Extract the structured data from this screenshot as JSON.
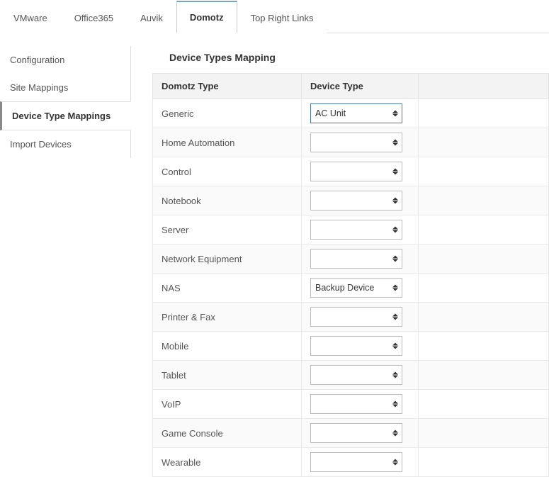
{
  "top_tabs": [
    {
      "label": "VMware",
      "active": false
    },
    {
      "label": "Office365",
      "active": false
    },
    {
      "label": "Auvik",
      "active": false
    },
    {
      "label": "Domotz",
      "active": true
    },
    {
      "label": "Top Right Links",
      "active": false
    }
  ],
  "sidebar": [
    {
      "label": "Configuration",
      "active": false
    },
    {
      "label": "Site Mappings",
      "active": false
    },
    {
      "label": "Device Type Mappings",
      "active": true
    },
    {
      "label": "Import Devices",
      "active": false
    }
  ],
  "section_title": "Device Types Mapping",
  "table": {
    "headers": {
      "domotz_type": "Domotz Type",
      "device_type": "Device Type"
    },
    "rows": [
      {
        "domotz_type": "Generic",
        "device_type": "AC Unit",
        "highlight": true
      },
      {
        "domotz_type": "Home Automation",
        "device_type": "",
        "highlight": false
      },
      {
        "domotz_type": "Control",
        "device_type": "",
        "highlight": false
      },
      {
        "domotz_type": "Notebook",
        "device_type": "",
        "highlight": false
      },
      {
        "domotz_type": "Server",
        "device_type": "",
        "highlight": false
      },
      {
        "domotz_type": "Network Equipment",
        "device_type": "",
        "highlight": false
      },
      {
        "domotz_type": "NAS",
        "device_type": "Backup Device",
        "highlight": false
      },
      {
        "domotz_type": "Printer & Fax",
        "device_type": "",
        "highlight": false
      },
      {
        "domotz_type": "Mobile",
        "device_type": "",
        "highlight": false
      },
      {
        "domotz_type": "Tablet",
        "device_type": "",
        "highlight": false
      },
      {
        "domotz_type": "VoIP",
        "device_type": "",
        "highlight": false
      },
      {
        "domotz_type": "Game Console",
        "device_type": "",
        "highlight": false
      },
      {
        "domotz_type": "Wearable",
        "device_type": "",
        "highlight": false
      }
    ]
  }
}
